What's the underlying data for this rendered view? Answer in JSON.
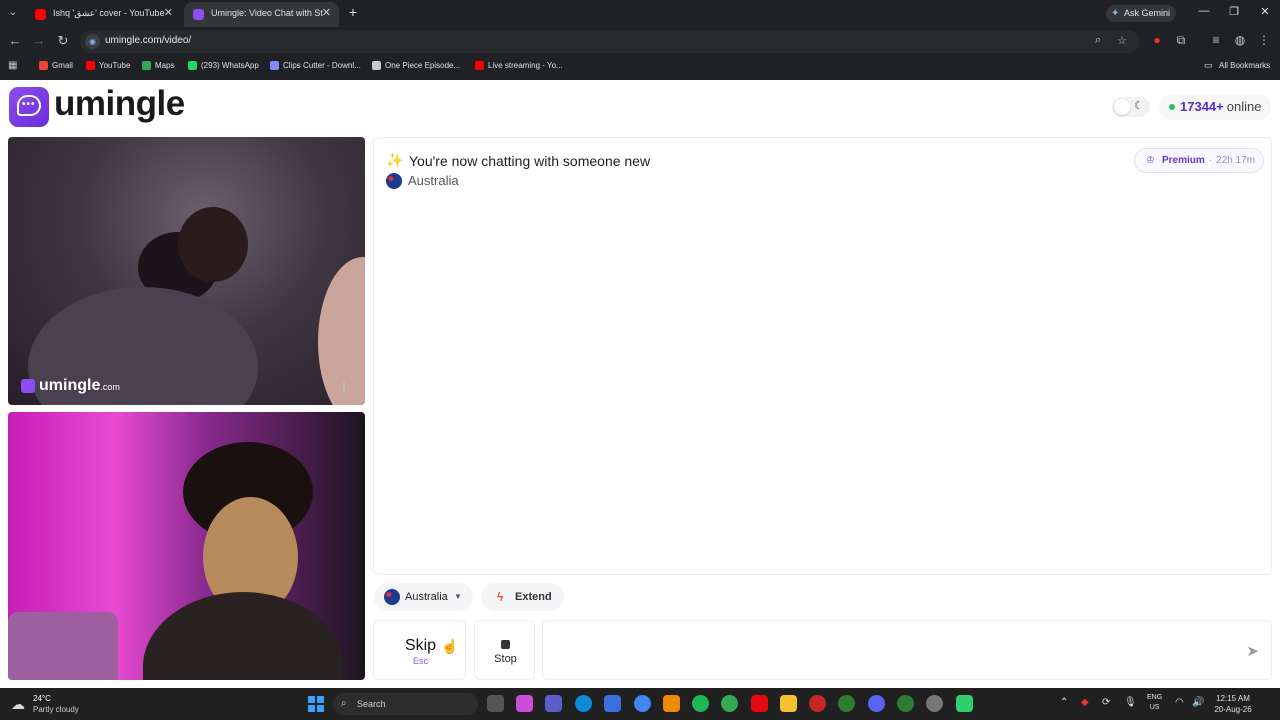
{
  "browser": {
    "tabs": [
      {
        "title": "Ishq 'عشق' cover - YouTube",
        "favicon_color": "#ff0000"
      },
      {
        "title": "Umingle: Video Chat with St",
        "favicon_color": "#8c4ef0"
      }
    ],
    "ask_gemini": "Ask Gemini",
    "url": "umingle.com/video/",
    "bookmarks": [
      "Gmail",
      "YouTube",
      "Maps",
      "(293) WhatsApp",
      "Clips Cutter - Downl...",
      "One Piece Episode...",
      "Live streaming - Yo..."
    ],
    "all_bookmarks": "All Bookmarks"
  },
  "header": {
    "logo_text": "umingle",
    "online_count": "17344+",
    "online_label": "online"
  },
  "remote_video": {
    "watermark": "umingle",
    "watermark_suffix": ".com"
  },
  "chat": {
    "title": "You're now chatting with someone new",
    "country": "Australia",
    "premium_label": "Premium",
    "premium_time": "22h 17m"
  },
  "controls": {
    "country_filter": "Australia",
    "extend_label": "Extend",
    "skip_label": "Skip",
    "skip_key": "Esc",
    "stop_label": "Stop"
  },
  "taskbar": {
    "temperature": "24°C",
    "weather": "Partly cloudy",
    "search_placeholder": "Search",
    "lang_top": "ENG",
    "lang_bottom": "US",
    "time": "12:15 AM",
    "date": "20-Aug-26"
  },
  "colors": {
    "accent": "#8c4ef0",
    "online_dot": "#23c552",
    "premium": "#6a34cc"
  }
}
